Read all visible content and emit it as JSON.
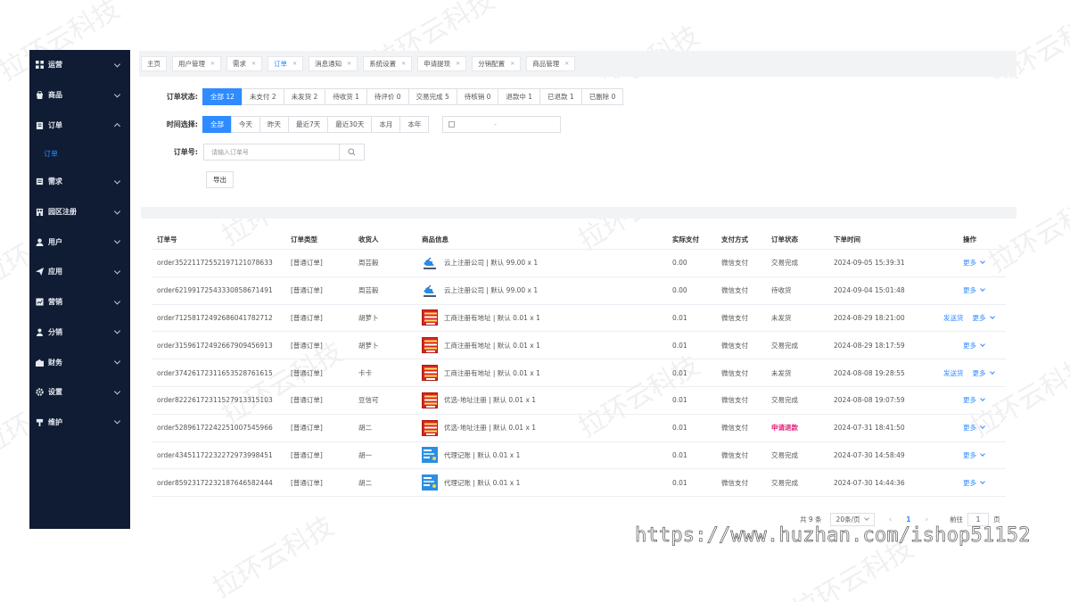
{
  "sidebar": {
    "items": [
      {
        "label": "运营",
        "icon": "grid-icon",
        "expanded": false
      },
      {
        "label": "商品",
        "icon": "bag-icon",
        "expanded": false
      },
      {
        "label": "订单",
        "icon": "clipboard-icon",
        "expanded": true
      },
      {
        "label": "需求",
        "icon": "list-icon",
        "expanded": false
      },
      {
        "label": "园区注册",
        "icon": "building-icon",
        "expanded": false
      },
      {
        "label": "用户",
        "icon": "user-icon",
        "expanded": false
      },
      {
        "label": "应用",
        "icon": "send-icon",
        "expanded": false
      },
      {
        "label": "营销",
        "icon": "chart-icon",
        "expanded": false
      },
      {
        "label": "分销",
        "icon": "person-icon",
        "expanded": false
      },
      {
        "label": "财务",
        "icon": "wallet-icon",
        "expanded": false
      },
      {
        "label": "设置",
        "icon": "gear-icon",
        "expanded": false
      },
      {
        "label": "维护",
        "icon": "tool-icon",
        "expanded": false
      }
    ],
    "sub_item": "订单"
  },
  "tabs": [
    {
      "label": "主页",
      "closable": false
    },
    {
      "label": "用户管理",
      "closable": true
    },
    {
      "label": "需求",
      "closable": true
    },
    {
      "label": "订单",
      "closable": true,
      "active": true
    },
    {
      "label": "消息通知",
      "closable": true
    },
    {
      "label": "系统设置",
      "closable": true
    },
    {
      "label": "申请提现",
      "closable": true
    },
    {
      "label": "分销配置",
      "closable": true
    },
    {
      "label": "商品管理",
      "closable": true
    }
  ],
  "filters": {
    "status_label": "订单状态:",
    "status_options": [
      "全部 12",
      "未支付 2",
      "未发货 2",
      "待收货 1",
      "待评价 0",
      "交易完成 5",
      "待核销 0",
      "退款中 1",
      "已退款 1",
      "已删除 0"
    ],
    "time_label": "时间选择:",
    "time_options": [
      "全部",
      "今天",
      "昨天",
      "最近7天",
      "最近30天",
      "本月",
      "本年"
    ],
    "date_separator": "-",
    "order_no_label": "订单号:",
    "order_no_placeholder": "请输入订单号",
    "export_label": "导出"
  },
  "table": {
    "headers": {
      "order_no": "订单号",
      "type": "订单类型",
      "receiver": "收货人",
      "goods": "商品信息",
      "paid": "实际支付",
      "pay_way": "支付方式",
      "status": "订单状态",
      "time": "下单时间",
      "op": "操作"
    },
    "rows": [
      {
        "no": "order35221172552197121078633",
        "type": "[普通订单]",
        "receiver": "周芸毅",
        "img": "cloud",
        "goods": "云上注册公司 | 默认   99.00 x 1",
        "paid": "0.00",
        "way": "微信支付",
        "status": "交易完成",
        "time": "2024-09-05 15:39:31",
        "ship": ""
      },
      {
        "no": "order62199172543330858671491",
        "type": "[普通订单]",
        "receiver": "周芸毅",
        "img": "cloud",
        "goods": "云上注册公司 | 默认   99.00 x 1",
        "paid": "0.00",
        "way": "微信支付",
        "status": "待收货",
        "time": "2024-09-04 15:01:48",
        "ship": ""
      },
      {
        "no": "order71258172492686041782712",
        "type": "[普通订单]",
        "receiver": "胡萝卜",
        "img": "red",
        "goods": "工商注册有地址 | 默认   0.01 x 1",
        "paid": "0.01",
        "way": "微信支付",
        "status": "未发货",
        "time": "2024-08-29 18:21:00",
        "ship": "发送货"
      },
      {
        "no": "order31596172492667909456913",
        "type": "[普通订单]",
        "receiver": "胡萝卜",
        "img": "red",
        "goods": "工商注册有地址 | 默认   0.01 x 1",
        "paid": "0.01",
        "way": "微信支付",
        "status": "交易完成",
        "time": "2024-08-29 18:17:59",
        "ship": ""
      },
      {
        "no": "order37426172311653528761615",
        "type": "[普通订单]",
        "receiver": "卡卡",
        "img": "red",
        "goods": "工商注册有地址 | 默认   0.01 x 1",
        "paid": "0.01",
        "way": "微信支付",
        "status": "未发货",
        "time": "2024-08-08 19:28:55",
        "ship": "发送货"
      },
      {
        "no": "order82226172311527913315103",
        "type": "[普通订单]",
        "receiver": "豆信可",
        "img": "red",
        "goods": "优选-地址注册 | 默认   0.01 x 1",
        "paid": "0.01",
        "way": "微信支付",
        "status": "交易完成",
        "time": "2024-08-08 19:07:59",
        "ship": ""
      },
      {
        "no": "order52896172242251007545966",
        "type": "[普通订单]",
        "receiver": "胡二",
        "img": "red",
        "goods": "优选-地址注册 | 默认   0.01 x 1",
        "paid": "0.01",
        "way": "微信支付",
        "status": "申请退款",
        "time": "2024-07-31 18:41:50",
        "ship": "",
        "status_color": "#e0217c"
      },
      {
        "no": "order43451172232272973998451",
        "type": "[普通订单]",
        "receiver": "胡一",
        "img": "blue",
        "goods": "代理记账 | 默认   0.01 x 1",
        "paid": "0.01",
        "way": "微信支付",
        "status": "交易完成",
        "time": "2024-07-30 14:58:49",
        "ship": ""
      },
      {
        "no": "order85923172232187646582444",
        "type": "[普通订单]",
        "receiver": "胡二",
        "img": "blue",
        "goods": "代理记账 | 默认   0.01 x 1",
        "paid": "0.01",
        "way": "微信支付",
        "status": "交易完成",
        "time": "2024-07-30 14:44:36",
        "ship": ""
      }
    ],
    "more_label": "更多"
  },
  "pager": {
    "total": "共 9 条",
    "size": "20条/页",
    "prev": "‹",
    "page": "1",
    "next": "›",
    "goto": "前往",
    "goto_value": "1",
    "page_unit": "页"
  },
  "watermark_url": "https://www.huzhan.com/ishop51152",
  "watermark_text": "拉环云科技",
  "colors": {
    "sidebar": "#0f1c33",
    "accent": "#2f8bff",
    "refund": "#e0217c"
  }
}
